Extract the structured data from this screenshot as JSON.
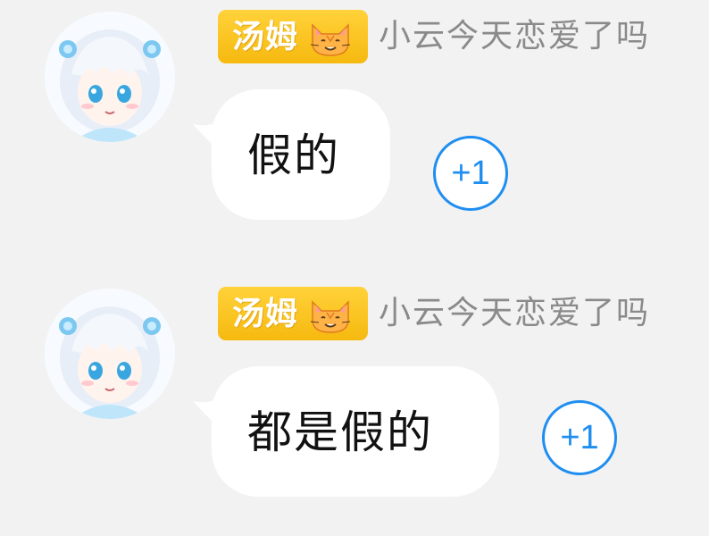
{
  "messages": [
    {
      "title_badge": "汤姆",
      "nickname": "小云今天恋爱了吗",
      "text": "假的",
      "plus_one": "+1"
    },
    {
      "title_badge": "汤姆",
      "nickname": "小云今天恋爱了吗",
      "text": "都是假的",
      "plus_one": "+1"
    }
  ],
  "colors": {
    "background": "#f2f2f2",
    "badge": "#f6b90f",
    "plus_one": "#1f8ef1",
    "nickname": "#8a8a8a"
  }
}
